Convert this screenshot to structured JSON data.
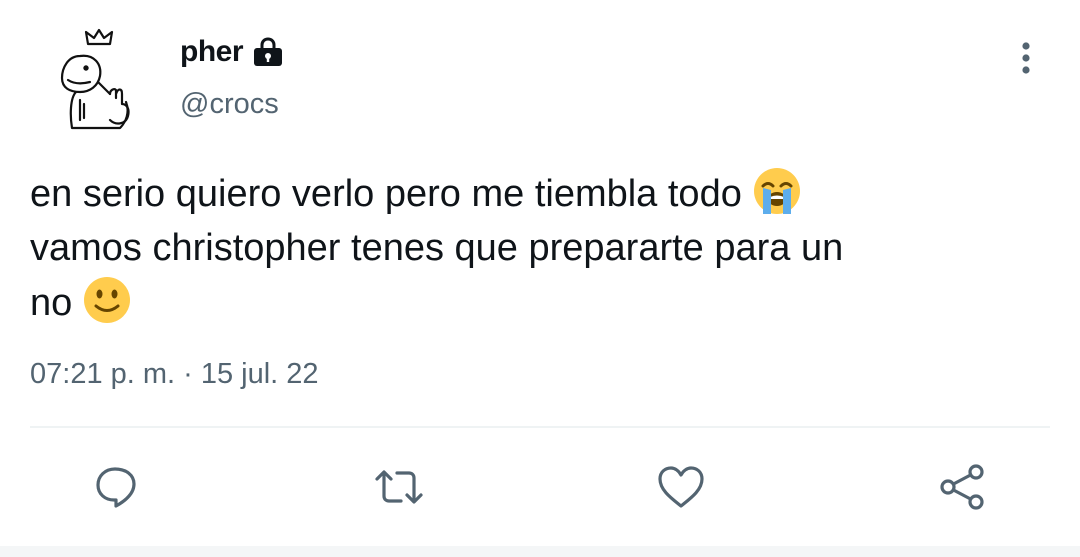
{
  "tweet": {
    "author": {
      "display_name": "pher",
      "handle": "@crocs",
      "protected": true
    },
    "text_lines": [
      "en serio quiero verlo pero me tiembla todo",
      "vamos christopher tenes que prepararte para un",
      "no"
    ],
    "emojis": [
      "loudly-crying-face",
      "slightly-smiling-face"
    ],
    "timestamp": "07:21 p. m. · 15 jul. 22"
  },
  "actions": [
    "reply",
    "retweet",
    "like",
    "share"
  ],
  "colors": {
    "text": "#0f1419",
    "secondary": "#536471",
    "divider": "#eff3f4"
  }
}
